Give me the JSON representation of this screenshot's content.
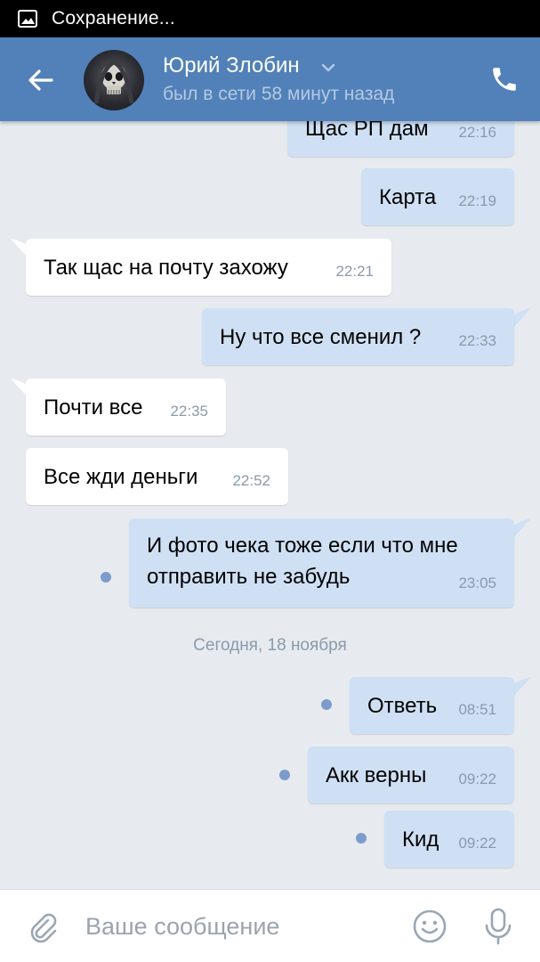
{
  "status_bar": {
    "text": "Сохранение..."
  },
  "header": {
    "name": "Юрий Злобин",
    "status": "был в сети 58 минут назад"
  },
  "messages": [
    {
      "dir": "out",
      "text": "Щас РП дам",
      "time": "22:16"
    },
    {
      "dir": "out",
      "text": "Карта",
      "time": "22:19"
    },
    {
      "dir": "in",
      "text": "Так щас на почту захожу",
      "time": "22:21"
    },
    {
      "dir": "out",
      "text": "Ну что все сменил ?",
      "time": "22:33"
    },
    {
      "dir": "in",
      "text": "Почти все",
      "time": "22:35"
    },
    {
      "dir": "in",
      "text": "Все жди деньги",
      "time": "22:52"
    },
    {
      "dir": "out",
      "lines": [
        "И фото чека тоже если что мне",
        "отправить не забудь"
      ],
      "time": "23:05",
      "unread": true
    },
    {
      "dir": "out",
      "text": "Ответь",
      "time": "08:51",
      "unread": true
    },
    {
      "dir": "out",
      "text": "Акк верны",
      "time": "09:22",
      "unread": true
    },
    {
      "dir": "out",
      "text": "Кид",
      "time": "09:22",
      "unread": true
    }
  ],
  "date_separator": "Сегодня, 18 ноября",
  "input": {
    "placeholder": "Ваше сообщение",
    "value": ""
  },
  "icons": {
    "status": "image-icon",
    "back": "arrow-left-icon",
    "chevron": "chevron-down-icon",
    "call": "phone-icon",
    "attach": "paperclip-icon",
    "emoji": "smiley-icon",
    "mic": "microphone-icon"
  },
  "colors": {
    "header": "#5181b8",
    "outgoing_bubble": "#cfe0f4",
    "incoming_bubble": "#ffffff",
    "chat_background": "#e7ebf0",
    "unread_dot": "#7c9ccb"
  }
}
